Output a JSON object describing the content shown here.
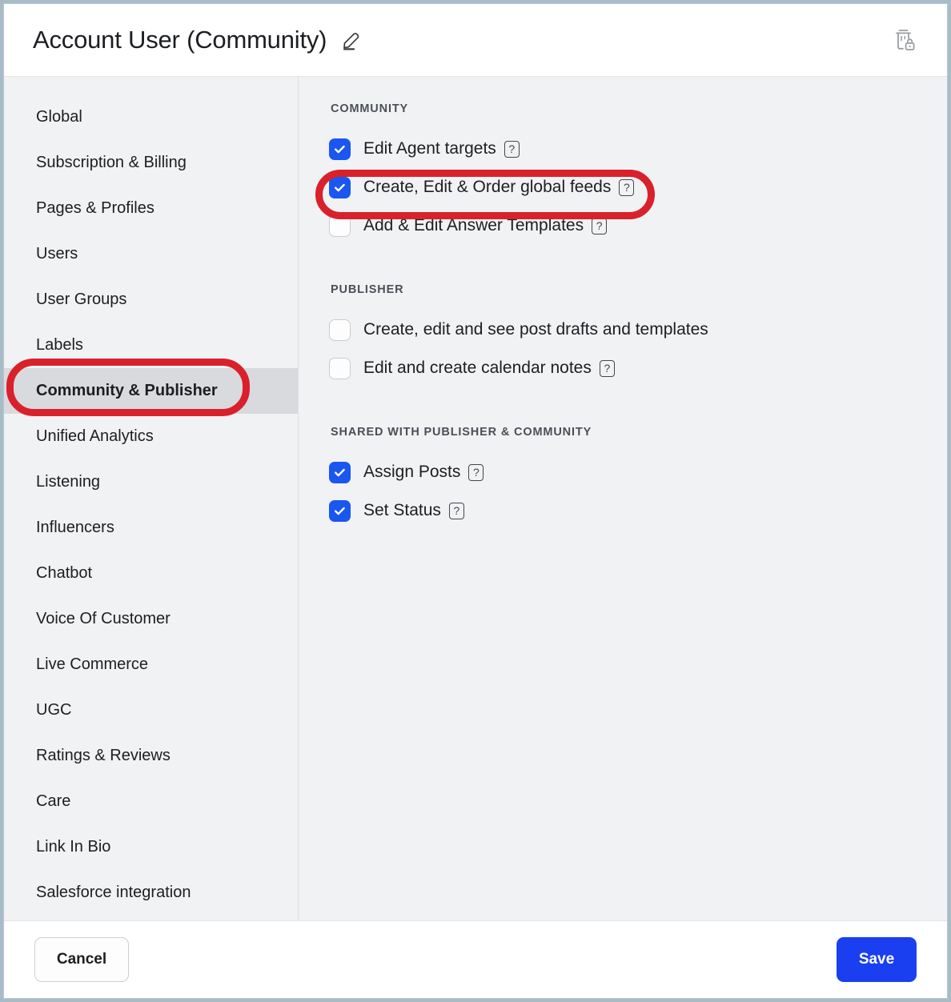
{
  "header": {
    "title": "Account User (Community)",
    "edit_icon": "pencil-icon",
    "delete_icon": "trash-lock-icon"
  },
  "sidebar": {
    "items": [
      {
        "label": "Global",
        "selected": false
      },
      {
        "label": "Subscription & Billing",
        "selected": false
      },
      {
        "label": "Pages & Profiles",
        "selected": false
      },
      {
        "label": "Users",
        "selected": false
      },
      {
        "label": "User Groups",
        "selected": false
      },
      {
        "label": "Labels",
        "selected": false
      },
      {
        "label": "Community & Publisher",
        "selected": true
      },
      {
        "label": "Unified Analytics",
        "selected": false
      },
      {
        "label": "Listening",
        "selected": false
      },
      {
        "label": "Influencers",
        "selected": false
      },
      {
        "label": "Chatbot",
        "selected": false
      },
      {
        "label": "Voice Of Customer",
        "selected": false
      },
      {
        "label": "Live Commerce",
        "selected": false
      },
      {
        "label": "UGC",
        "selected": false
      },
      {
        "label": "Ratings & Reviews",
        "selected": false
      },
      {
        "label": "Care",
        "selected": false
      },
      {
        "label": "Link In Bio",
        "selected": false
      },
      {
        "label": "Salesforce integration",
        "selected": false
      }
    ]
  },
  "content": {
    "sections": [
      {
        "title": "COMMUNITY",
        "permissions": [
          {
            "label": "Edit Agent targets",
            "checked": true,
            "help": true
          },
          {
            "label": "Create, Edit & Order global feeds",
            "checked": true,
            "help": true
          },
          {
            "label": "Add & Edit Answer Templates",
            "checked": false,
            "help": true
          }
        ]
      },
      {
        "title": "PUBLISHER",
        "permissions": [
          {
            "label": "Create, edit and see post drafts and templates",
            "checked": false,
            "help": false
          },
          {
            "label": "Edit and create calendar notes",
            "checked": false,
            "help": true
          }
        ]
      },
      {
        "title": "SHARED WITH PUBLISHER & COMMUNITY",
        "permissions": [
          {
            "label": "Assign Posts",
            "checked": true,
            "help": true
          },
          {
            "label": "Set Status",
            "checked": true,
            "help": true
          }
        ]
      }
    ],
    "help_glyph": "?"
  },
  "footer": {
    "cancel_label": "Cancel",
    "save_label": "Save"
  },
  "annotations": [
    {
      "name": "sidebar-highlight",
      "target": "Community & Publisher"
    },
    {
      "name": "permission-highlight",
      "target": "Create, Edit & Order global feeds"
    }
  ],
  "colors": {
    "accent_blue": "#1a56f0",
    "save_blue": "#1a3ff0",
    "annotation_red": "#d9212b",
    "panel_bg": "#f1f2f4",
    "selected_item_bg": "#d9dade"
  }
}
